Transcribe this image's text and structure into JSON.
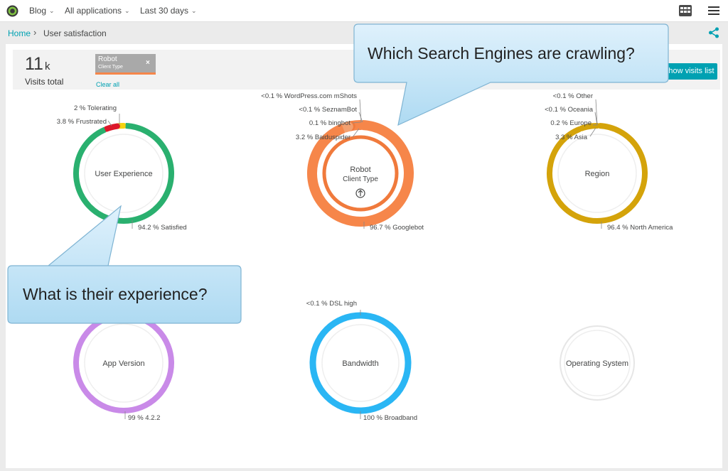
{
  "topbar": {
    "nav": [
      {
        "label": "Blog"
      },
      {
        "label": "All applications"
      },
      {
        "label": "Last 30 days"
      }
    ]
  },
  "breadcrumb": {
    "home": "Home",
    "separator": "›",
    "current": "User satisfaction"
  },
  "summary": {
    "visits_value": "11",
    "visits_unit": "k",
    "visits_label": "Visits total",
    "filter": {
      "title": "Robot",
      "subtitle": "Client Type",
      "remove": "×"
    },
    "clear_all": "Clear all",
    "show_visits_button": "Show visits list"
  },
  "colors": {
    "accent": "#00a1b2",
    "satisfied": "#2ab06f",
    "tolerating": "#f5d30f",
    "frustrated": "#dc172a",
    "robot": "#f6864a",
    "region": "#d4a30a",
    "app_version": "#c98ae8",
    "bandwidth": "#2ab6f4",
    "empty": "#e6e6e6"
  },
  "chart_data": [
    {
      "type": "pie",
      "title": "User Experience",
      "segments": [
        {
          "label": "94.2 % Satisfied",
          "value": 94.2,
          "color": "#2ab06f"
        },
        {
          "label": "2 % Tolerating",
          "value": 2,
          "color": "#f5d30f"
        },
        {
          "label": "3.8 % Frustrated",
          "value": 3.8,
          "color": "#dc172a"
        }
      ]
    },
    {
      "type": "pie",
      "title": "Robot",
      "subtitle": "Client Type",
      "segments": [
        {
          "label": "96.7 % Googlebot",
          "value": 96.7
        },
        {
          "label": "3.2 % Baiduspider",
          "value": 3.2
        },
        {
          "label": "0.1 % bingbot",
          "value": 0.1
        },
        {
          "label": "<0.1 % SeznamBot",
          "value": 0.05
        },
        {
          "label": "<0.1 % WordPress.com mShots",
          "value": 0.05
        }
      ]
    },
    {
      "type": "pie",
      "title": "Region",
      "segments": [
        {
          "label": "96.4 % North America",
          "value": 96.4
        },
        {
          "label": "3.3 % Asia",
          "value": 3.3
        },
        {
          "label": "0.2 % Europe",
          "value": 0.2
        },
        {
          "label": "<0.1 % Oceania",
          "value": 0.05
        },
        {
          "label": "<0.1 % Other",
          "value": 0.05
        }
      ]
    },
    {
      "type": "pie",
      "title": "App Version",
      "segments": [
        {
          "label": "99 % 4.2.2",
          "value": 99
        }
      ]
    },
    {
      "type": "pie",
      "title": "Bandwidth",
      "segments": [
        {
          "label": "100 % Broadband",
          "value": 100
        },
        {
          "label": "<0.1 % DSL high",
          "value": 0.05
        }
      ]
    },
    {
      "type": "pie",
      "title": "Operating System",
      "segments": []
    }
  ],
  "callouts": {
    "search_engines": "Which Search Engines are crawling?",
    "experience": "What is their experience?"
  }
}
